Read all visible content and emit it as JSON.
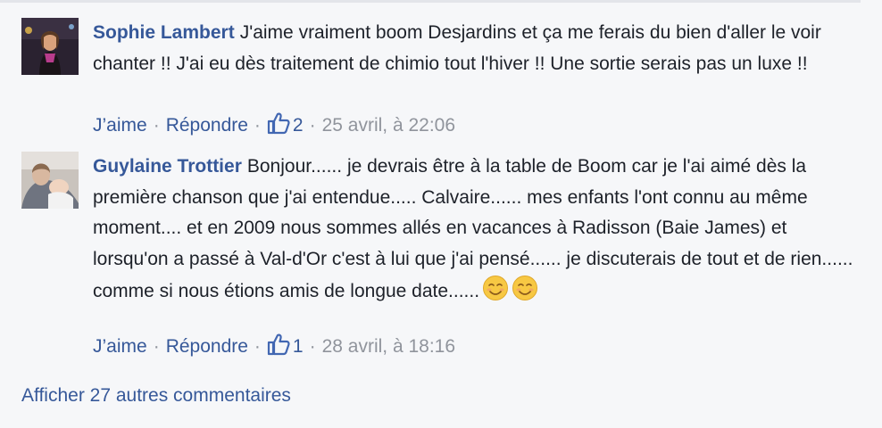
{
  "comments": [
    {
      "author": "Sophie Lambert",
      "text": "J'aime vraiment boom Desjardins et ça me ferais du bien d'aller le voir chanter !! J'ai eu dès traitement de chimio tout l'hiver !! Une sortie serais pas un luxe !!",
      "like_label": "J’aime",
      "reply_label": "Répondre",
      "like_count": "2",
      "timestamp": "25 avril, à 22:06",
      "separator": "·"
    },
    {
      "author": "Guylaine Trottier",
      "text": "Bonjour...... je devrais être à la table de Boom car je l'ai aimé dès la première chanson que j'ai entendue..... Calvaire...... mes enfants l'ont connu au même moment.... et en 2009 nous sommes allés en vacances à Radisson (Baie James) et lorsqu'on a passé à Val-d'Or c'est à lui que j'ai pensé...... je discuterais de tout et de rien...... comme si nous étions amis de longue date......",
      "like_label": "J’aime",
      "reply_label": "Répondre",
      "like_count": "1",
      "timestamp": "28 avril, à 18:16",
      "separator": "·"
    }
  ],
  "more_comments_label": "Afficher 27 autres commentaires",
  "icons": {
    "like": "thumbs-up-icon",
    "emoji": "smiling-face-icon"
  },
  "colors": {
    "link": "#365899",
    "text": "#1d2129",
    "meta": "#90949c",
    "background": "#f6f7f9"
  }
}
